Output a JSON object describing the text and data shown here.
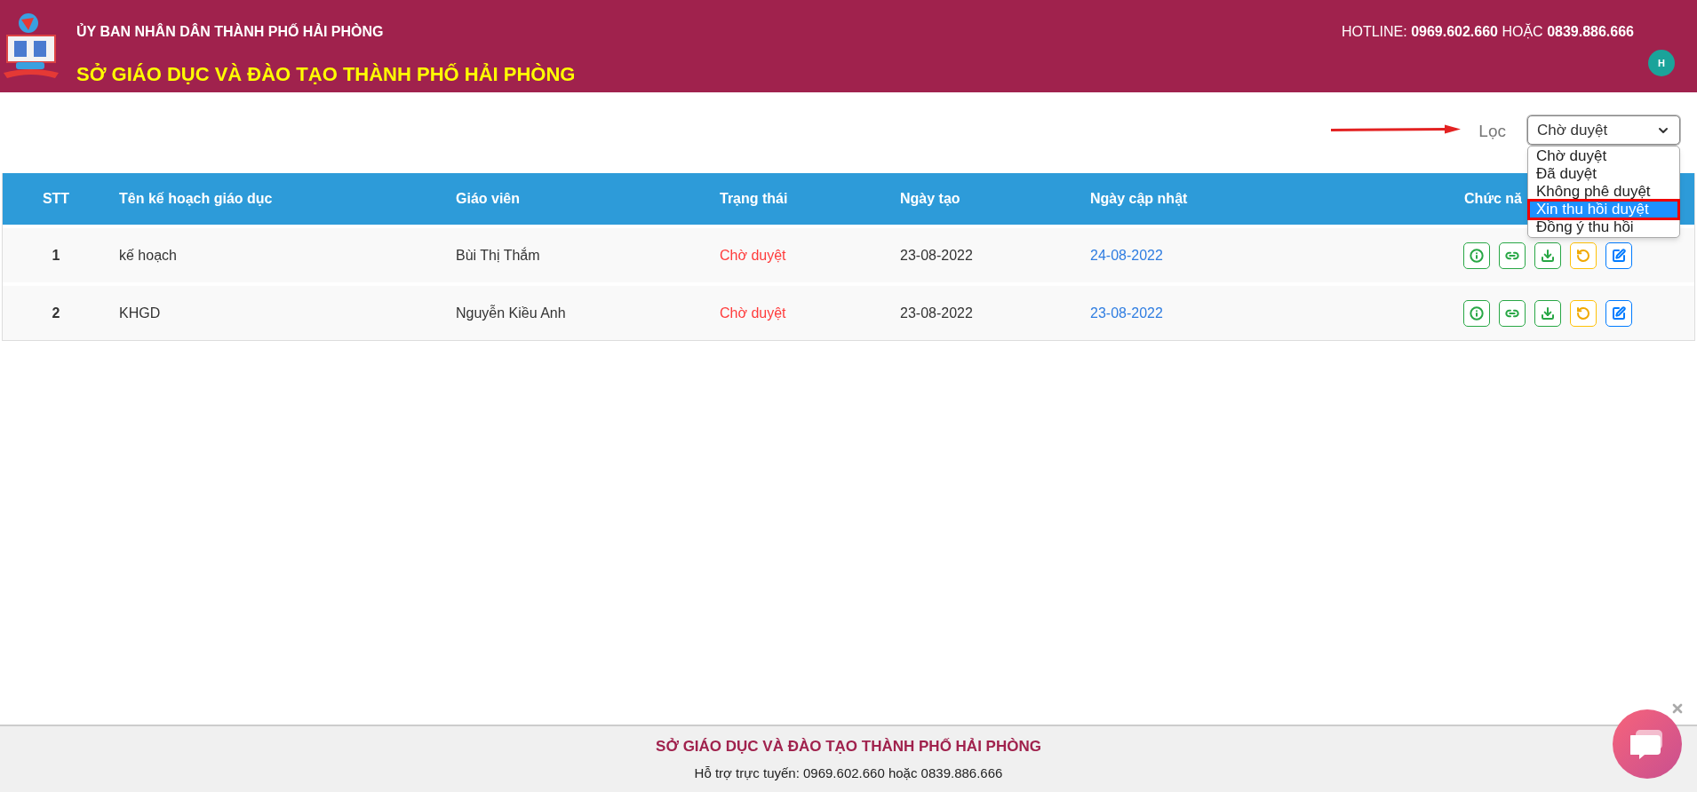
{
  "header": {
    "subtitle": "ỦY BAN NHÂN DÂN THÀNH PHỐ HẢI PHÒNG",
    "title": "SỞ GIÁO DỤC VÀ ĐÀO TẠO THÀNH PHỐ HẢI PHÒNG",
    "hotline": "HOTLINE: **0969.602.660** HOẶC **0839.886.666**",
    "avatar": "H"
  },
  "filter": {
    "label": "Lọc",
    "value": "Chờ duyệt",
    "expanded": true,
    "options": [
      {
        "label": "Chờ duyệt",
        "highlighted": false
      },
      {
        "label": "Đã duyệt",
        "highlighted": false
      },
      {
        "label": "Không phê duyệt",
        "highlighted": false
      },
      {
        "label": "Xin thu hồi duyệt",
        "highlighted": true
      },
      {
        "label": "Đồng ý thu hồi",
        "highlighted": false
      }
    ]
  },
  "table": {
    "columns": [
      "STT",
      "Tên kế hoạch giáo dục",
      "Giáo viên",
      "Trạng thái",
      "Ngày tạo",
      "Ngày cập nhật",
      "Chức nă"
    ],
    "rows": [
      {
        "stt": "1",
        "name": "kế hoạch",
        "teacher": "Bùi Thị Thắm",
        "status": "Chờ duyệt",
        "created": "23-08-2022",
        "updated": "24-08-2022",
        "actions": [
          {
            "kind": "info"
          },
          {
            "kind": "link"
          },
          {
            "kind": "download"
          },
          {
            "kind": "revoke"
          },
          {
            "kind": "edit"
          }
        ]
      },
      {
        "stt": "2",
        "name": "KHGD",
        "teacher": "Nguyễn Kiều Anh",
        "status": "Chờ duyệt",
        "created": "23-08-2022",
        "updated": "23-08-2022",
        "actions": [
          {
            "kind": "info"
          },
          {
            "kind": "link"
          },
          {
            "kind": "download"
          },
          {
            "kind": "revoke"
          },
          {
            "kind": "edit"
          }
        ]
      }
    ]
  },
  "footer": {
    "title": "SỞ GIÁO DỤC VÀ ĐÀO TẠO THÀNH PHỐ HẢI PHÒNG",
    "support": "Hỗ trợ trực tuyến: 0969.602.660 hoặc 0839.886.666"
  }
}
